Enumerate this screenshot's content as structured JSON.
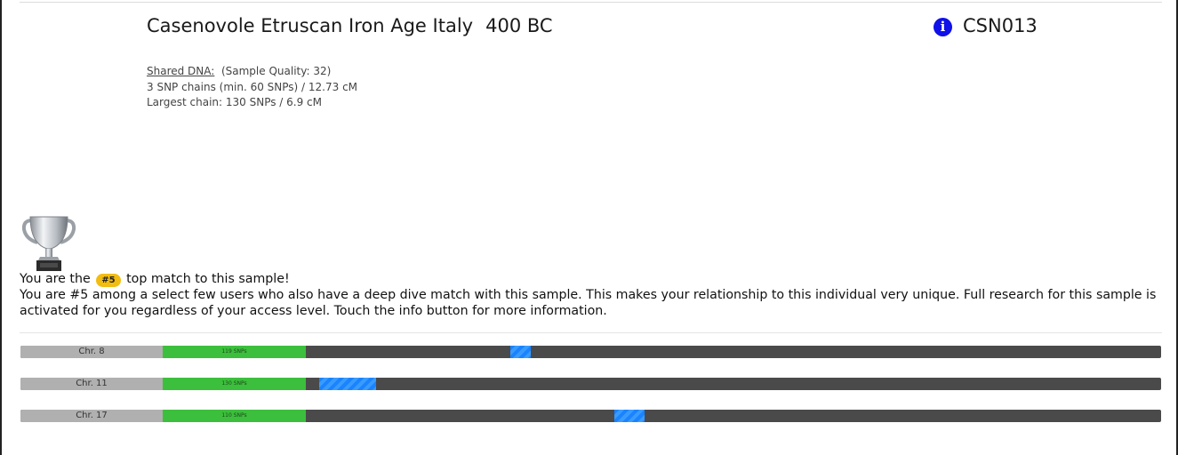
{
  "sample": {
    "title": "Casenovole Etruscan Iron Age Italy",
    "date": "400 BC",
    "id": "CSN013",
    "info_icon": "info-icon"
  },
  "shared_dna": {
    "label": "Shared DNA:",
    "quality": "(Sample Quality: 32)",
    "chains": "3 SNP chains (min. 60 SNPs) / 12.73 cM",
    "largest": "Largest chain: 130 SNPs / 6.9 cM"
  },
  "match": {
    "trophy_icon": "trophy-icon",
    "line_prefix": "You are the",
    "rank_badge": "#5",
    "line_suffix": "top match to this sample!",
    "description": "You are #5 among a select few users who also have a deep dive match with this sample. This makes your relationship to this individual very unique. Full research for this sample is activated for you regardless of your access level. Touch the info button for more information."
  },
  "chromosomes": [
    {
      "name": "Chr. 8",
      "snps": "119 SNPs",
      "segment_start": 0.4296,
      "segment_end": 0.4475
    },
    {
      "name": "Chr. 11",
      "snps": "130 SNPs",
      "segment_start": 0.2619,
      "segment_end": 0.3118
    },
    {
      "name": "Chr. 17",
      "snps": "110 SNPs",
      "segment_start": 0.5206,
      "segment_end": 0.5471
    }
  ],
  "colors": {
    "info": "#1010e8",
    "badge": "#f2bd12",
    "chromosome_bar": "#4a4a4a",
    "snp_block": "#3cbf3c",
    "segment": "#1a83ff"
  }
}
